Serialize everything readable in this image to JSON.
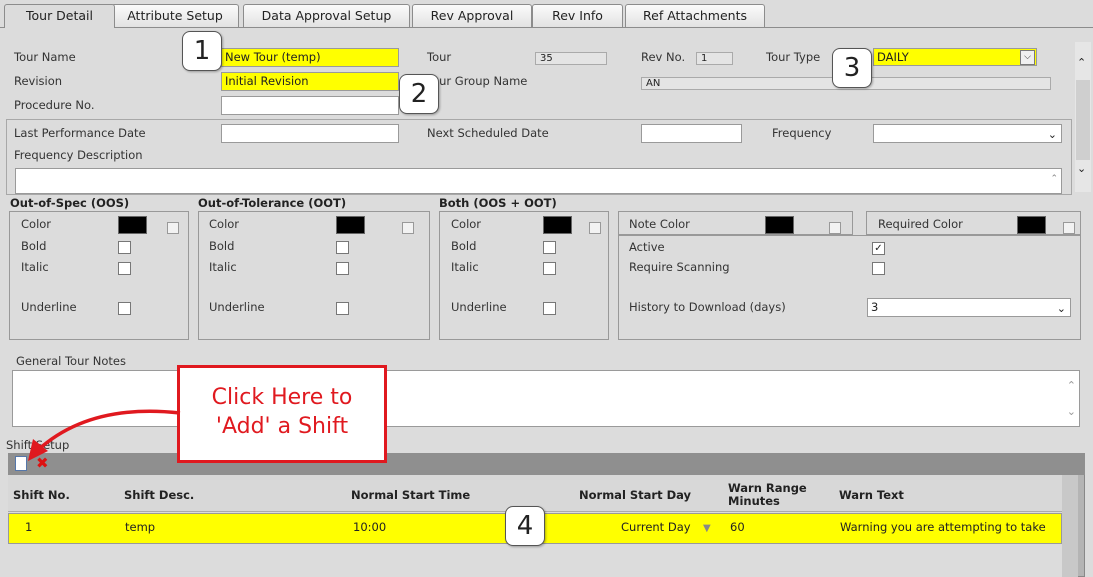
{
  "tabs": [
    "Tour Detail",
    "Attribute Setup",
    "Data Approval Setup",
    "Rev Approval",
    "Rev Info",
    "Ref Attachments"
  ],
  "form": {
    "tour_name_label": "Tour Name",
    "tour_name_value": "New Tour (temp)",
    "revision_label": "Revision",
    "revision_value": "Initial Revision",
    "procedure_label": "Procedure No.",
    "tour_label": "Tour",
    "tour_value": "35",
    "rev_no_label": "Rev No.",
    "rev_no_value": "1",
    "tour_type_label": "Tour Type",
    "tour_type_value": "DAILY",
    "tour_group_label": "Tour Group Name",
    "tour_group_value": "AN",
    "last_perf_label": "Last Performance Date",
    "next_sched_label": "Next Scheduled Date",
    "frequency_label": "Frequency",
    "freq_desc_label": "Frequency Description"
  },
  "groups": {
    "oos": {
      "title": "Out-of-Spec (OOS)"
    },
    "oot": {
      "title": "Out-of-Tolerance (OOT)"
    },
    "both": {
      "title": "Both (OOS + OOT)"
    },
    "color": "Color",
    "bold": "Bold",
    "italic": "Italic",
    "underline": "Underline"
  },
  "settings": {
    "note_color": "Note Color",
    "required_color": "Required Color",
    "active": "Active",
    "require_scanning": "Require Scanning",
    "history_label": "History to Download (days)",
    "history_value": "3"
  },
  "notes": {
    "label": "General Tour Notes"
  },
  "shift": {
    "section_label": "Shift Setup",
    "columns": [
      "Shift No.",
      "Shift Desc.",
      "Normal Start Time",
      "Normal Start Day",
      "Warn Range Minutes",
      "Warn Text"
    ],
    "rows": [
      {
        "no": "1",
        "desc": "temp",
        "time": "10:00",
        "day": "Current Day",
        "warn_min": "60",
        "warn_text": "Warning you are attempting to take"
      }
    ]
  },
  "callouts": {
    "c1": "1",
    "c2": "2",
    "c3": "3",
    "c4": "4",
    "add_line1": "Click Here to",
    "add_line2": "'Add' a Shift"
  },
  "colors": {
    "highlight": "#ffff00",
    "callout_red": "#e0191f"
  }
}
